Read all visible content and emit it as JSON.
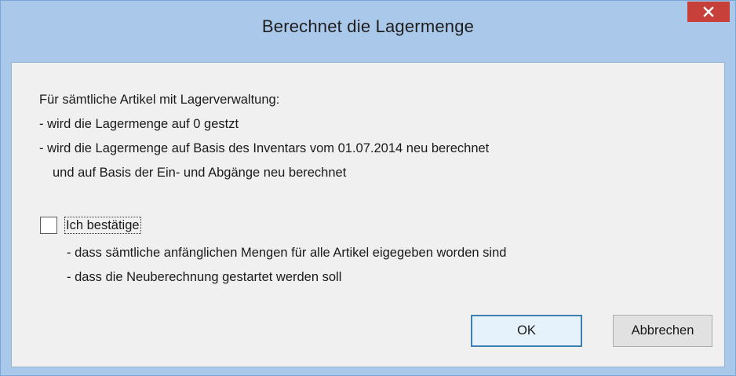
{
  "dialog": {
    "title": "Berechnet die Lagermenge",
    "close_icon": "close-icon"
  },
  "info": {
    "heading": "Für sämtliche Artikel mit Lagerverwaltung:",
    "line1": "-  wird die Lagermenge auf 0 gestzt",
    "line2": "-  wird die Lagermenge auf Basis des Inventars vom 01.07.2014 neu berechnet",
    "line3": "und auf Basis der Ein- und Abgänge neu berechnet"
  },
  "confirm": {
    "checked": false,
    "label": "Ich bestätige",
    "item1": "-  dass sämtliche anfänglichen Mengen für alle Artikel eigegeben worden sind",
    "item2": "-  dass die Neuberechnung gestartet werden soll"
  },
  "buttons": {
    "ok_label": "OK",
    "cancel_label": "Abbrechen"
  },
  "colors": {
    "frame": "#aac8ea",
    "close_button": "#c7413a",
    "client": "#f0f0f0"
  }
}
